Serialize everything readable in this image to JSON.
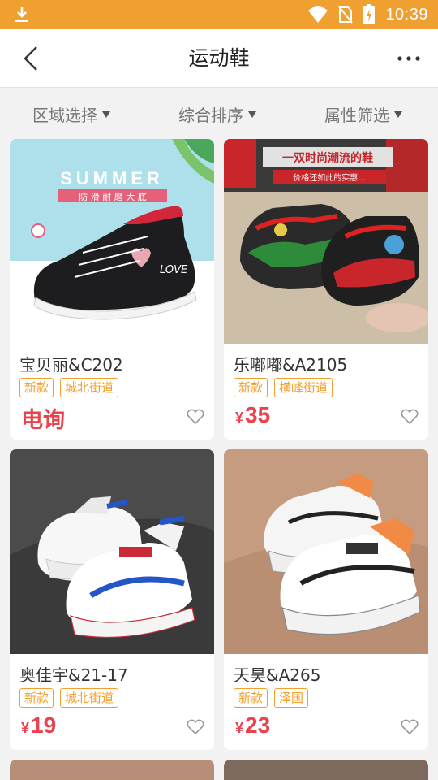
{
  "status_bar": {
    "time": "10:39",
    "icons": [
      "download-icon",
      "wifi-icon",
      "no-sim-icon",
      "battery-charging-icon"
    ],
    "bg_color": "#f0a030"
  },
  "header": {
    "title": "运动鞋",
    "back_icon": "chevron-left-icon",
    "more_icon": "more-horizontal-icon"
  },
  "filters": [
    {
      "label": "区域选择",
      "icon": "triangle-down-icon"
    },
    {
      "label": "综合排序",
      "icon": "triangle-down-icon"
    },
    {
      "label": "属性筛选",
      "icon": "triangle-down-icon"
    }
  ],
  "products": [
    {
      "name": "宝贝丽&C202",
      "tags": [
        "新款",
        "城北街道"
      ],
      "price_text": "电询",
      "currency": "",
      "image": {
        "banner_title": "SUMMER",
        "banner_subtitle": "防 滑 耐 磨 大 底",
        "shoe_text": "LOVE"
      }
    },
    {
      "name": "乐嘟嘟&A2105",
      "tags": [
        "新款",
        "横峰街道"
      ],
      "price_text": "35",
      "currency": "¥",
      "image": {
        "banner_title": "一双时尚潮流的鞋",
        "banner_subtitle": "价格还如此的实惠..."
      }
    },
    {
      "name": "奥佳宇&21-17",
      "tags": [
        "新款",
        "城北街道"
      ],
      "price_text": "19",
      "currency": "¥",
      "image": {}
    },
    {
      "name": "天昊&A265",
      "tags": [
        "新款",
        "泽国"
      ],
      "price_text": "23",
      "currency": "¥",
      "image": {}
    }
  ],
  "colors": {
    "accent": "#f0a030",
    "price": "#e9434e"
  }
}
